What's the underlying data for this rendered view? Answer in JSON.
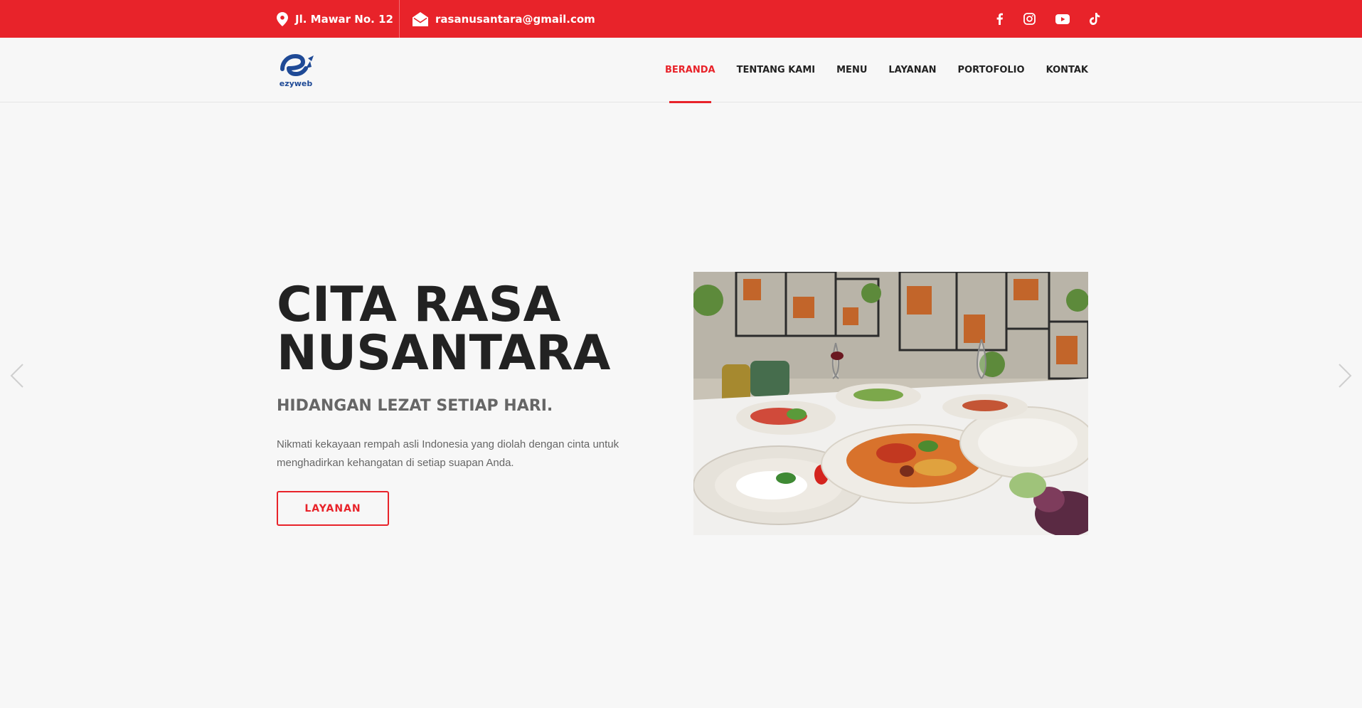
{
  "topbar": {
    "address": "Jl. Mawar No. 12",
    "email": "rasanusantara@gmail.com",
    "icons": {
      "address": "map-pin-icon",
      "email": "envelope-open-icon"
    },
    "socials": [
      "facebook-icon",
      "instagram-icon",
      "youtube-icon",
      "tiktok-icon"
    ],
    "color": "#e8232a"
  },
  "header": {
    "logo_text": "ezyweb",
    "nav": [
      {
        "label": "BERANDA",
        "active": true
      },
      {
        "label": "TENTANG KAMI",
        "active": false
      },
      {
        "label": "MENU",
        "active": false
      },
      {
        "label": "LAYANAN",
        "active": false
      },
      {
        "label": "PORTOFOLIO",
        "active": false
      },
      {
        "label": "KONTAK",
        "active": false
      }
    ]
  },
  "hero": {
    "title_line1": "CITA RASA",
    "title_line2": "NUSANTARA",
    "subtitle": "HIDANGAN LEZAT SETIAP HARI.",
    "description": "Nikmati kekayaan rempah asli Indonesia yang diolah dengan cinta untuk menghadirkan kehangatan di setiap suapan Anda.",
    "button_label": "LAYANAN"
  },
  "colors": {
    "accent": "#e8232a",
    "brand_blue": "#1f4a96",
    "text_dark": "#222222",
    "text_muted": "#666666"
  }
}
